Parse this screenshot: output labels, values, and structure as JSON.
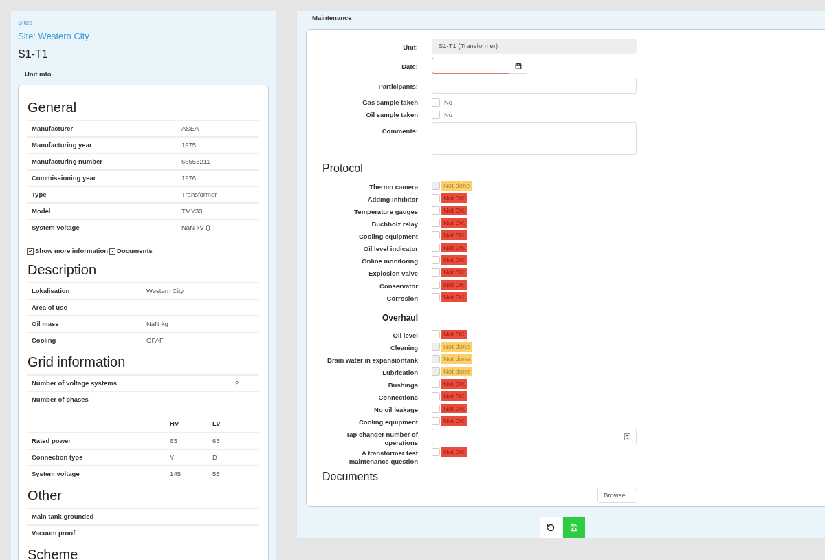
{
  "breadcrumb": {
    "sites": "Sites",
    "site": "Site: Western City"
  },
  "unit_title": "S1-T1",
  "unit_tab": "Unit info",
  "general": {
    "title": "General",
    "rows": [
      {
        "label": "Manufacturer",
        "value": "ASEA"
      },
      {
        "label": "Manufacturing year",
        "value": "1975"
      },
      {
        "label": "Manufacturing number",
        "value": "66553211"
      },
      {
        "label": "Commissioning year",
        "value": "1976"
      },
      {
        "label": "Type",
        "value": "Transformer"
      },
      {
        "label": "Model",
        "value": "TMY33"
      },
      {
        "label": "System voltage",
        "value": "NaN kV ()"
      }
    ]
  },
  "options": [
    {
      "label": "Show more information",
      "checked": true
    },
    {
      "label": "Documents",
      "checked": true
    }
  ],
  "description": {
    "title": "Description",
    "rows": [
      {
        "label": "Lokalisation",
        "value": "Western City"
      },
      {
        "label": "Area of use"
      },
      {
        "label": "Oil mass",
        "value": "NaN kg"
      },
      {
        "label": "Cooling",
        "value": "OFAF"
      }
    ]
  },
  "grid_information": {
    "title": "Grid information",
    "rows": [
      {
        "label": "Number of voltage systems",
        "value": "2"
      },
      {
        "label": "Number of phases"
      }
    ],
    "phase_table": {
      "columns": [
        "HV",
        "LV"
      ],
      "rows": [
        {
          "label": "Rated power",
          "values": [
            "63",
            "63"
          ]
        },
        {
          "label": "Connection type",
          "values": [
            "Y",
            "D"
          ]
        },
        {
          "label": "System voltage",
          "values": [
            "145",
            "55"
          ]
        }
      ]
    }
  },
  "other": {
    "title": "Other",
    "rows": [
      {
        "label": "Main tank grounded"
      },
      {
        "label": "Vacuum proof"
      }
    ]
  },
  "scheme": {
    "title": "Scheme"
  },
  "maintenance": {
    "tab": "Maintenance",
    "fields": [
      {
        "kind": "readonly",
        "label": "Unit:",
        "value": "S1-T1 (Transformer)"
      },
      {
        "kind": "date",
        "label": "Date:",
        "invalid": true
      },
      {
        "kind": "text",
        "label": "Participants:"
      },
      {
        "kind": "checkbox",
        "label": "Gas sample taken",
        "checked": false,
        "text": "No"
      },
      {
        "kind": "checkbox",
        "label": "Oil sample taken",
        "checked": false,
        "text": "No"
      },
      {
        "kind": "textarea",
        "label": "Comments:"
      }
    ],
    "protocol": {
      "title": "Protocol",
      "items": [
        {
          "kind": "not_done",
          "label": "Thermo camera",
          "checked": false,
          "status": "Not done"
        },
        {
          "kind": "not_ok",
          "label": "Adding inhibitor",
          "checked": false,
          "status": "Not OK"
        },
        {
          "kind": "not_ok",
          "label": "Temperature gauges",
          "checked": false,
          "status": "Not OK"
        },
        {
          "kind": "not_ok",
          "label": "Buchholz relay",
          "checked": false,
          "status": "Not OK"
        },
        {
          "kind": "not_ok",
          "label": "Cooling equipment",
          "checked": false,
          "status": "Not OK"
        },
        {
          "kind": "not_ok",
          "label": "Oil level indicator",
          "checked": false,
          "status": "Not OK"
        },
        {
          "kind": "not_ok",
          "label": "Online monitoring",
          "checked": false,
          "status": "Not OK"
        },
        {
          "kind": "not_ok",
          "label": "Explosion valve",
          "checked": false,
          "status": "Not OK"
        },
        {
          "kind": "not_ok",
          "label": "Conservator",
          "checked": false,
          "status": "Not OK"
        },
        {
          "kind": "not_ok",
          "label": "Corrosion",
          "checked": false,
          "status": "Not OK"
        }
      ]
    },
    "overhaul": {
      "title": "Overhaul",
      "items": [
        {
          "kind": "not_ok",
          "label": "Oil level",
          "checked": false,
          "status": "Not OK"
        },
        {
          "kind": "not_done",
          "label": "Cleaning",
          "checked": false,
          "status": "Not done"
        },
        {
          "kind": "not_done",
          "label": "Drain water in expansiontank",
          "checked": false,
          "status": "Not done"
        },
        {
          "kind": "not_done",
          "label": "Lubrication",
          "checked": false,
          "status": "Not done"
        },
        {
          "kind": "not_ok",
          "label": "Bushings",
          "checked": false,
          "status": "Not OK"
        },
        {
          "kind": "not_ok",
          "label": "Connections",
          "checked": false,
          "status": "Not OK"
        },
        {
          "kind": "not_ok",
          "label": "No oil leakage",
          "checked": false,
          "status": "Not OK"
        },
        {
          "kind": "not_ok",
          "label": "Cooling equipment",
          "checked": false,
          "status": "Not OK"
        },
        {
          "kind": "number",
          "label": "Tap changer number of operations"
        },
        {
          "kind": "not_ok",
          "label": "A transformer test maintenance question",
          "checked": false,
          "status": "Not OK"
        }
      ]
    },
    "documents": {
      "title": "Documents",
      "browse": "Browse..."
    }
  }
}
